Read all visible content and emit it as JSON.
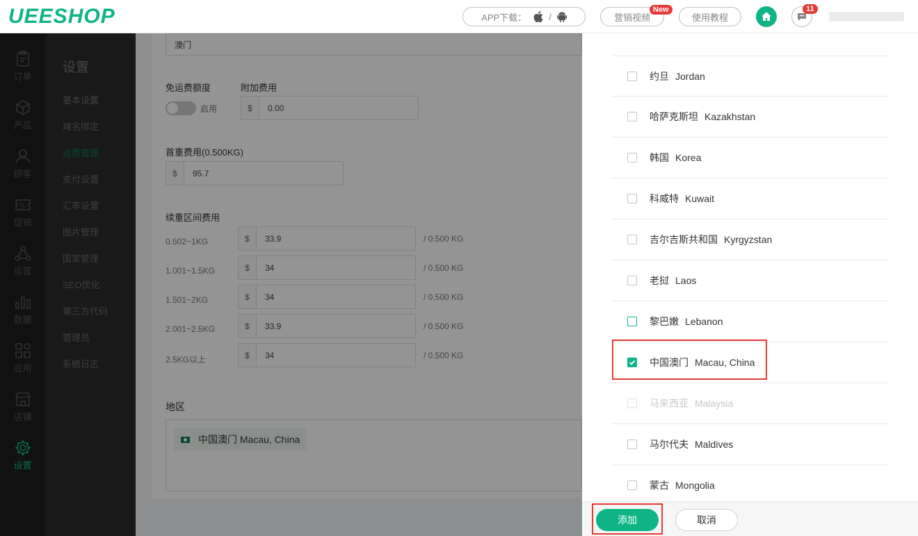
{
  "header": {
    "logo": "UEESHOP",
    "app_download": "APP下载：",
    "app_separator": "/",
    "marketing_video": "营销视频",
    "new_badge": "New",
    "tutorial": "使用教程",
    "message_count": "11"
  },
  "nav": {
    "items": [
      {
        "label": "订单",
        "icon": "clipboard-icon"
      },
      {
        "label": "产品",
        "icon": "box-icon"
      },
      {
        "label": "顾客",
        "icon": "user-icon"
      },
      {
        "label": "促销",
        "icon": "coupon-icon"
      },
      {
        "label": "运营",
        "icon": "network-icon"
      },
      {
        "label": "数据",
        "icon": "bar-chart-icon"
      },
      {
        "label": "应用",
        "icon": "apps-icon"
      },
      {
        "label": "店铺",
        "icon": "store-icon"
      },
      {
        "label": "设置",
        "icon": "gear-icon"
      }
    ]
  },
  "submenu": {
    "title": "设置",
    "items": [
      "基本设置",
      "域名绑定",
      "运费管理",
      "支付设置",
      "汇率设置",
      "图片管理",
      "国家管理",
      "SEO优化",
      "第三方代码",
      "管理员",
      "系统日志"
    ]
  },
  "form": {
    "name_value": "澳门",
    "free_shipping_label": "免运费额度",
    "toggle_label": "启用",
    "extra_fee_label": "附加费用",
    "currency": "$",
    "extra_fee_value": "0.00",
    "first_weight_label": "首重费用(0.500KG)",
    "first_weight_value": "95.7",
    "continued_label": "续重区间费用",
    "ranges": [
      {
        "range": "0.502~1KG",
        "value": "33.9",
        "unit": "/ 0.500 KG"
      },
      {
        "range": "1.001~1.5KG",
        "value": "34",
        "unit": "/ 0.500 KG"
      },
      {
        "range": "1.501~2KG",
        "value": "34",
        "unit": "/ 0.500 KG"
      },
      {
        "range": "2.001~2.5KG",
        "value": "33.9",
        "unit": "/ 0.500 KG"
      },
      {
        "range": "2.5KG以上",
        "value": "34",
        "unit": "/ 0.500 KG"
      }
    ],
    "region_label": "地区",
    "region_tag": "中国澳门  Macau, China"
  },
  "panel": {
    "countries": [
      {
        "zh": "约旦",
        "en": "Jordan",
        "state": "unchecked"
      },
      {
        "zh": "哈萨克斯坦",
        "en": "Kazakhstan",
        "state": "unchecked"
      },
      {
        "zh": "韩国",
        "en": "Korea",
        "state": "unchecked"
      },
      {
        "zh": "科威特",
        "en": "Kuwait",
        "state": "unchecked"
      },
      {
        "zh": "吉尔吉斯共和国",
        "en": "Kyrgyzstan",
        "state": "unchecked"
      },
      {
        "zh": "老挝",
        "en": "Laos",
        "state": "unchecked"
      },
      {
        "zh": "黎巴嫩",
        "en": "Lebanon",
        "state": "hover"
      },
      {
        "zh": "中国澳门",
        "en": "Macau, China",
        "state": "checked"
      },
      {
        "zh": "马来西亚",
        "en": "Malaysia",
        "state": "disabled"
      },
      {
        "zh": "马尔代夫",
        "en": "Maldives",
        "state": "unchecked"
      },
      {
        "zh": "蒙古",
        "en": "Mongolia",
        "state": "unchecked"
      }
    ],
    "add_button": "添加",
    "cancel_button": "取消"
  },
  "colors": {
    "accent": "#0eb486",
    "highlight": "#e53935"
  }
}
